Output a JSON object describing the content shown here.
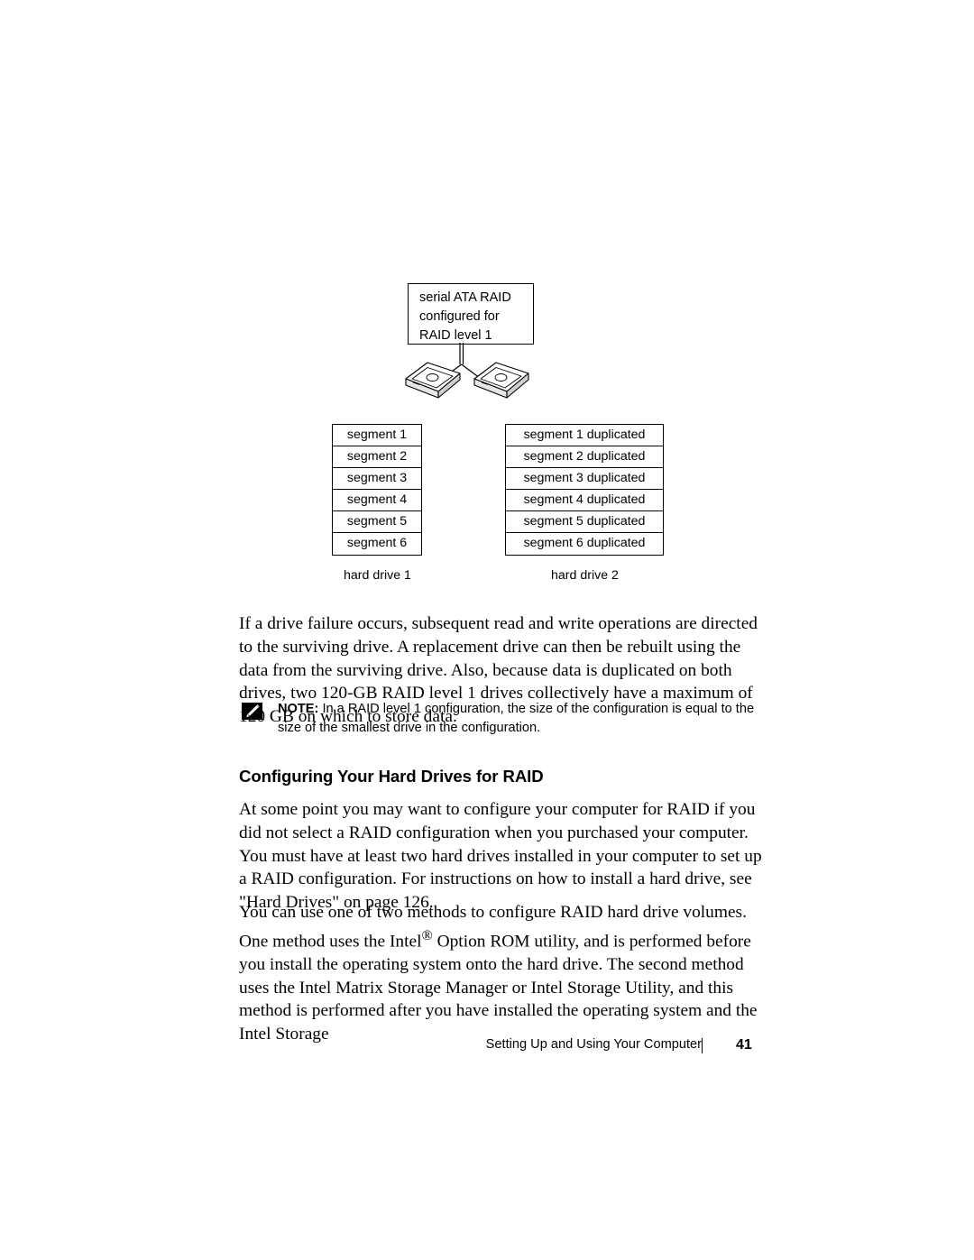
{
  "figure": {
    "raid_box": {
      "line1": "serial ATA RAID",
      "line2": "configured for",
      "line3": "RAID level 1"
    },
    "drive_illustration_alt": "two hard drives connected by a Y shaped bus line",
    "left_table": {
      "rows": [
        "segment 1",
        "segment 2",
        "segment 3",
        "segment 4",
        "segment 5",
        "segment 6"
      ],
      "caption": "hard drive 1"
    },
    "right_table": {
      "rows": [
        "segment 1 duplicated",
        "segment 2 duplicated",
        "segment 3 duplicated",
        "segment 4 duplicated",
        "segment 5 duplicated",
        "segment 6 duplicated"
      ],
      "caption": "hard drive 2"
    }
  },
  "body": {
    "paragraph_1": "If a drive failure occurs, subsequent read and write operations are directed to the surviving drive. A replacement drive can then be rebuilt using the data from the surviving drive. Also, because data is duplicated on both drives, two 120-GB RAID level 1 drives collectively have a maximum of 120 GB on which to store data.",
    "note": {
      "label": "NOTE:",
      "text": " In a RAID level 1 configuration, the size of the configuration is equal to the size of the smallest drive in the configuration."
    },
    "heading": "Configuring Your Hard Drives for RAID",
    "paragraph_3": "At some point you may want to configure your computer for RAID if you did not select a RAID configuration when you purchased your computer. You must have at least two hard drives installed in your computer to set up a RAID configuration. For instructions on how to install a hard drive, see \"Hard Drives\" on page 126.",
    "paragraph_4_part1": "You can use one of two methods to configure RAID hard drive volumes. One method uses the Intel",
    "paragraph_4_sup": "®",
    "paragraph_4_part2": " Option ROM utility, and is performed before you install the operating system onto the hard drive. The second method uses the Intel Matrix Storage Manager or Intel Storage Utility, and this method is performed after you have installed the operating system and the Intel Storage"
  },
  "footer": {
    "title": "Setting Up and Using Your Computer",
    "page_number": "41"
  },
  "colors": {
    "text": "#000000",
    "background": "#ffffff",
    "rule": "#000000"
  }
}
